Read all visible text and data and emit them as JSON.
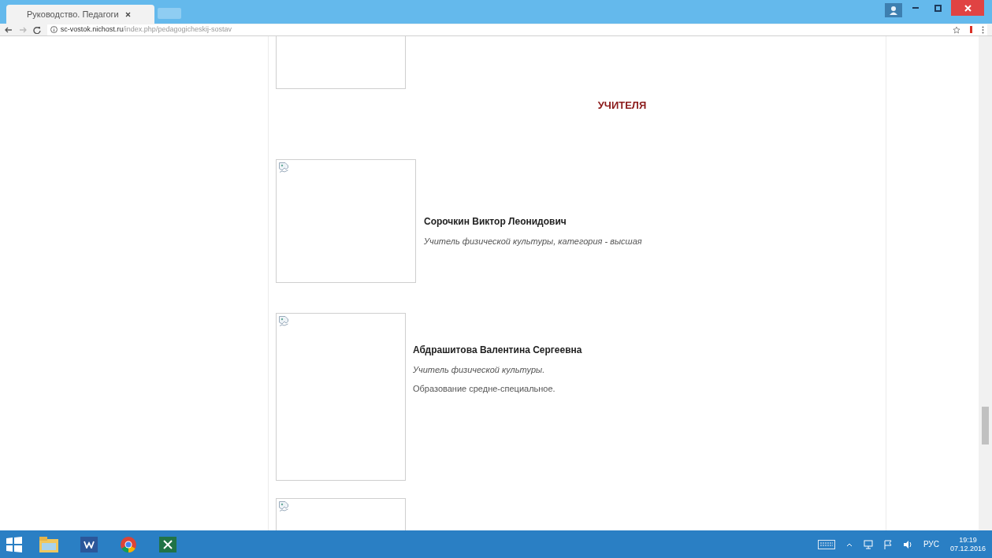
{
  "browser": {
    "tab_title": "Руководство. Педагоги",
    "url_host": "sc-vostok.nichost.ru",
    "url_path": "/index.php/pedagogicheskij-sostav"
  },
  "page": {
    "heading": "УЧИТЕЛЯ",
    "teachers": [
      {
        "name": "Сорочкин Виктор Леонидович",
        "lines": [
          {
            "text": "Учитель физической культуры, категория - высшая",
            "italic": true
          }
        ]
      },
      {
        "name": "Абдрашитова Валентина Сергеевна",
        "lines": [
          {
            "text": "Учитель физической культуры.",
            "italic": true
          },
          {
            "text": "Образование средне-специальное.",
            "italic": false
          }
        ]
      }
    ]
  },
  "taskbar": {
    "language": "РУС",
    "time": "19:19",
    "date": "07.12.2016"
  }
}
